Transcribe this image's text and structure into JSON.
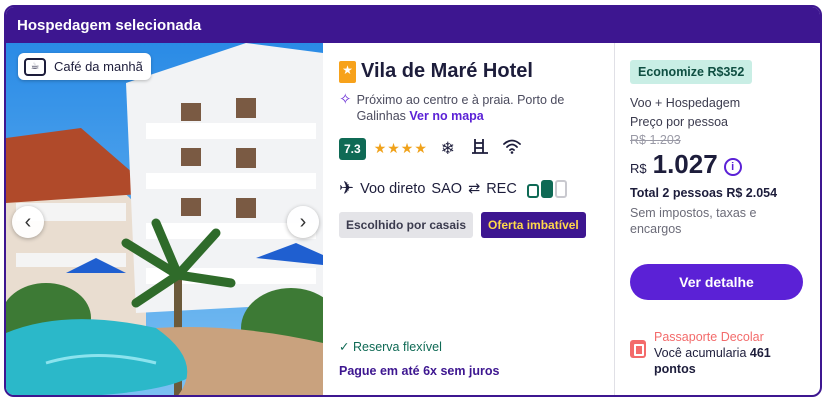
{
  "header": {
    "title": "Hospedagem selecionada"
  },
  "photo": {
    "badge_label": "Café da manhã",
    "prev_icon": "chevron-left-icon",
    "next_icon": "chevron-right-icon"
  },
  "hotel": {
    "name": "Vila de Maré Hotel",
    "location": "Próximo ao centro e à praia. Porto de Galinhas",
    "map_link": "Ver no mapa",
    "score": "7.3",
    "stars": 4,
    "amenities": [
      "snowflake-icon",
      "pool-ladder-icon",
      "wifi-icon"
    ]
  },
  "flight": {
    "label": "Voo direto",
    "from": "SAO",
    "to": "REC"
  },
  "tags": {
    "couples": "Escolhido por casais",
    "deal": "Oferta imbatível"
  },
  "booking": {
    "flexible": "Reserva flexível",
    "installments": "Pague em até 6x sem juros"
  },
  "price": {
    "savings": "Economize R$352",
    "package": "Voo + Hospedagem",
    "per_person": "Preço por pessoa",
    "old_price": "R$ 1.203",
    "currency": "R$",
    "amount": "1.027",
    "total": "Total 2 pessoas R$ 2.054",
    "taxes": "Sem impostos, taxas e encargos",
    "cta": "Ver detalhe"
  },
  "passport": {
    "title": "Passaporte Decolar",
    "text_prefix": "Você acumularia",
    "points": "461",
    "text_suffix": "pontos"
  },
  "colors": {
    "brand": "#3d1690",
    "accent": "#5b21d6",
    "green": "#0f6a55",
    "star": "#f0a21b",
    "passport": "#f36b6b"
  }
}
